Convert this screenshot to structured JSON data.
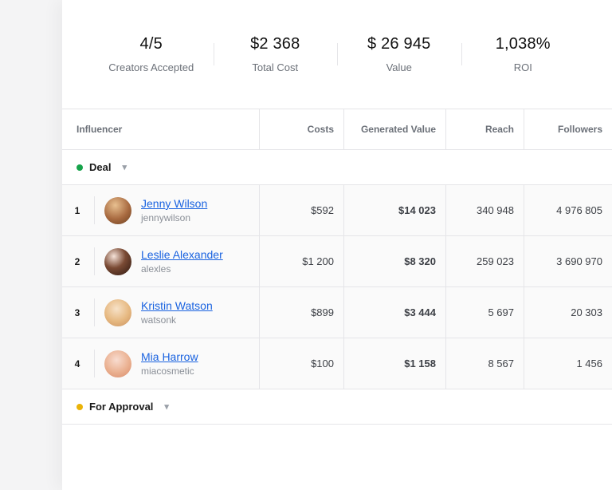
{
  "stats": {
    "accepted": {
      "value": "4/5",
      "label": "Creators Accepted"
    },
    "cost": {
      "value": "$2 368",
      "label": "Total Cost"
    },
    "val": {
      "value": "$ 26 945",
      "label": "Value"
    },
    "roi": {
      "value": "1,038%",
      "label": "ROI"
    }
  },
  "columns": {
    "influencer": "Influencer",
    "costs": "Costs",
    "generated": "Generated Value",
    "reach": "Reach",
    "followers": "Followers"
  },
  "groups": {
    "deal": "Deal",
    "approval": "For Approval"
  },
  "rows": [
    {
      "rank": "1",
      "name": "Jenny Wilson",
      "handle": "jennywilson",
      "costs": "$592",
      "generated": "$14 023",
      "reach": "340 948",
      "followers": "4 976 805"
    },
    {
      "rank": "2",
      "name": "Leslie Alexander",
      "handle": "alexles",
      "costs": "$1 200",
      "generated": "$8 320",
      "reach": "259 023",
      "followers": "3 690 970"
    },
    {
      "rank": "3",
      "name": "Kristin Watson",
      "handle": "watsonk",
      "costs": "$899",
      "generated": "$3 444",
      "reach": "5 697",
      "followers": "20 303"
    },
    {
      "rank": "4",
      "name": "Mia Harrow",
      "handle": "miacosmetic",
      "costs": "$100",
      "generated": "$1 158",
      "reach": "8 567",
      "followers": "1 456"
    }
  ]
}
